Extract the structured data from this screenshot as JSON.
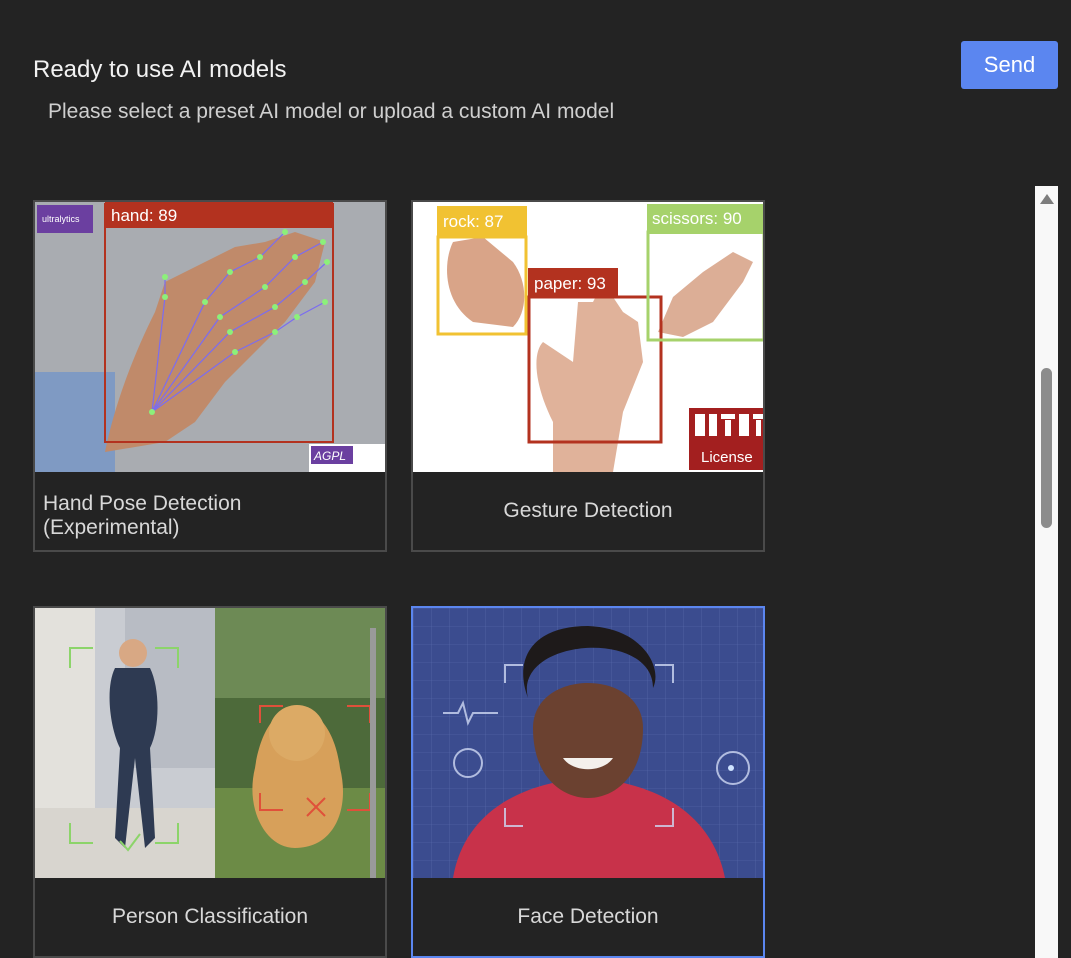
{
  "header": {
    "title": "Ready to use AI models",
    "subtitle": "Please select a preset AI model or upload a custom AI model",
    "send_label": "Send"
  },
  "cards": [
    {
      "label": "Hand Pose Detection (Experimental)",
      "detections": [
        "hand: 89"
      ],
      "logo_text": "ultralytics",
      "license_text": "AGPL"
    },
    {
      "label": "Gesture Detection",
      "detections": [
        "rock: 87",
        "paper: 93",
        "scissors: 90"
      ],
      "license_text": "License"
    },
    {
      "label": "Person Classification"
    },
    {
      "label": "Face Detection",
      "selected": true
    }
  ],
  "colors": {
    "accent": "#5b86f0",
    "background": "#232323",
    "card_border": "#4a4a4a",
    "hand_box": "#b3321f",
    "rock_box": "#f1c232",
    "paper_box": "#b3321f",
    "scissors_box": "#a6d26b"
  },
  "icons": [
    "scroll-up-arrow-icon"
  ]
}
